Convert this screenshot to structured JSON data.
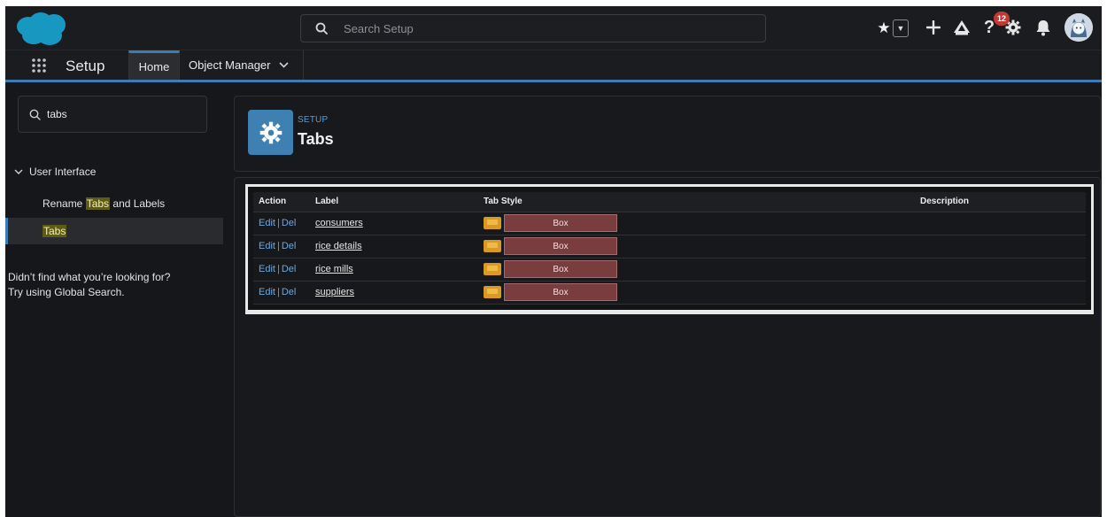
{
  "header": {
    "search_placeholder": "Search Setup",
    "notification_count": "12",
    "icons": [
      "salesforce-cloud-logo",
      "favorites-star-icon",
      "chevron-down-icon",
      "plus-icon",
      "trailhead-icon",
      "help-icon",
      "gear-icon",
      "bell-icon",
      "avatar"
    ]
  },
  "nav": {
    "app_name": "Setup",
    "tabs": [
      {
        "label": "Home",
        "active": true
      },
      {
        "label": "Object Manager",
        "active": false
      }
    ]
  },
  "sidebar": {
    "quickfind_value": "tabs",
    "section_label": "User Interface",
    "items": [
      {
        "pre": "Rename ",
        "hl": "Tabs",
        "post": " and Labels",
        "active": false
      },
      {
        "pre": "",
        "hl": "Tabs",
        "post": "",
        "active": true
      }
    ],
    "help_line1": "Didn’t find what you’re looking for?",
    "help_line2": "Try using Global Search."
  },
  "page": {
    "eyebrow": "SETUP",
    "title": "Tabs"
  },
  "table": {
    "columns": [
      "Action",
      "Label",
      "Tab Style",
      "Description"
    ],
    "edit_label": "Edit",
    "separator": "|",
    "del_label": "Del",
    "rows": [
      {
        "label": "consumers",
        "tab_style": "Box",
        "description": ""
      },
      {
        "label": "rice details",
        "tab_style": "Box",
        "description": ""
      },
      {
        "label": "rice mills",
        "tab_style": "Box",
        "description": ""
      },
      {
        "label": "suppliers",
        "tab_style": "Box",
        "description": ""
      }
    ]
  },
  "colors": {
    "accent": "#3d7bb3",
    "background": "#16171a",
    "link": "#6ca6e0",
    "tab_style_swatch": "#7a3d3f",
    "badge": "#c23934",
    "highlight": "#5e5a18"
  }
}
